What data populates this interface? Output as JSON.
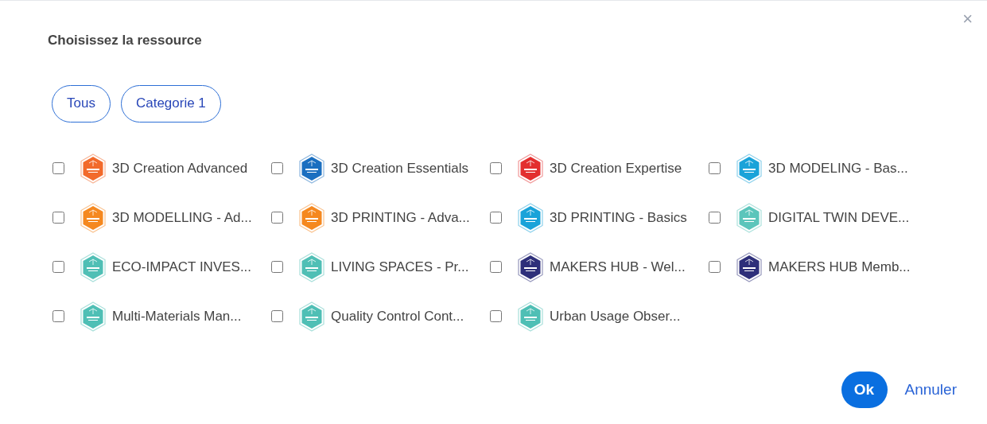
{
  "dialog": {
    "title": "Choisissez la ressource",
    "close": "×"
  },
  "filters": [
    {
      "label": "Tous"
    },
    {
      "label": "Categorie 1"
    }
  ],
  "resources": [
    {
      "name": "3D Creation Advanced",
      "checked": false,
      "color": "#f26a2b"
    },
    {
      "name": "3D Creation Essentials",
      "checked": false,
      "color": "#1b6fc0"
    },
    {
      "name": "3D Creation Expertise",
      "checked": false,
      "color": "#e32f2f"
    },
    {
      "name": "3D MODELING - Bas...",
      "checked": false,
      "color": "#1aa3d9"
    },
    {
      "name": "3D MODELLING - Ad...",
      "checked": false,
      "color": "#f5881f"
    },
    {
      "name": "3D PRINTING - Adva...",
      "checked": false,
      "color": "#f5881f"
    },
    {
      "name": "3D PRINTING - Basics",
      "checked": false,
      "color": "#1aa3d9"
    },
    {
      "name": "DIGITAL TWIN DEVE...",
      "checked": false,
      "color": "#5cc5bb"
    },
    {
      "name": "ECO-IMPACT INVES...",
      "checked": false,
      "color": "#4fbfb5"
    },
    {
      "name": "LIVING SPACES - Pr...",
      "checked": false,
      "color": "#4fbfb5"
    },
    {
      "name": "MAKERS HUB - Wel...",
      "checked": false,
      "color": "#2e2f7a"
    },
    {
      "name": "MAKERS HUB Memb...",
      "checked": false,
      "color": "#2e2f7a"
    },
    {
      "name": "Multi-Materials Man...",
      "checked": false,
      "color": "#4fbfb5"
    },
    {
      "name": "Quality Control Cont...",
      "checked": false,
      "color": "#4fbfb5"
    },
    {
      "name": "Urban Usage Obser...",
      "checked": false,
      "color": "#4fbfb5"
    }
  ],
  "buttons": {
    "ok": "Ok",
    "cancel": "Annuler"
  }
}
